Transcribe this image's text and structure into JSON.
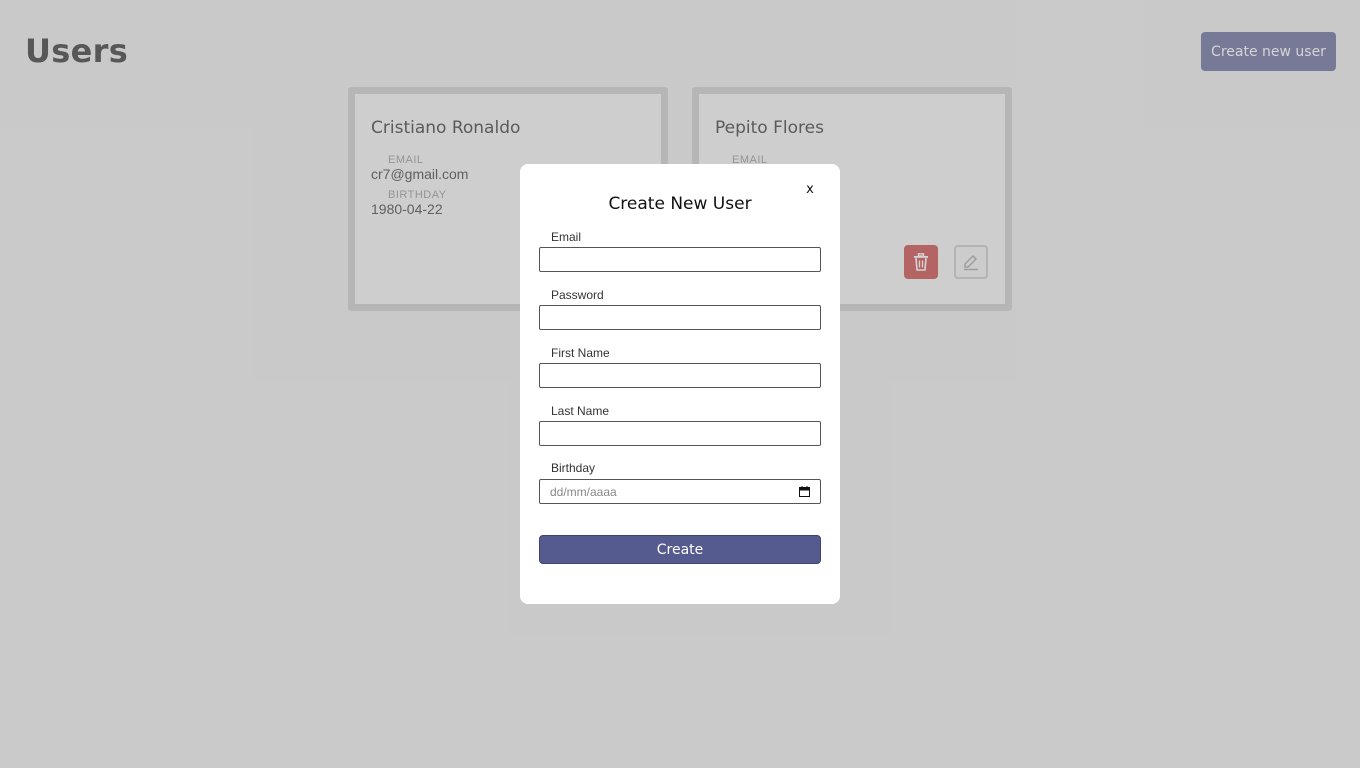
{
  "header": {
    "title": "Users",
    "create_button_label": "Create new user"
  },
  "users": [
    {
      "name": "Cristiano Ronaldo",
      "email_label": "EMAIL",
      "email": "cr7@gmail.com",
      "birthday_label": "BIRTHDAY",
      "birthday": "1980-04-22"
    },
    {
      "name": "Pepito Flores",
      "email_label": "EMAIL"
    }
  ],
  "modal": {
    "title": "Create New User",
    "close_label": "x",
    "fields": {
      "email_label": "Email",
      "password_label": "Password",
      "first_name_label": "First Name",
      "last_name_label": "Last Name",
      "birthday_label": "Birthday",
      "birthday_placeholder": "dd/mm/aaaa"
    },
    "submit_label": "Create"
  },
  "colors": {
    "accent": "#565b8f",
    "danger": "#c63434"
  },
  "icons": {
    "delete": "trash-icon",
    "edit": "pencil-icon",
    "calendar": "calendar-icon"
  }
}
